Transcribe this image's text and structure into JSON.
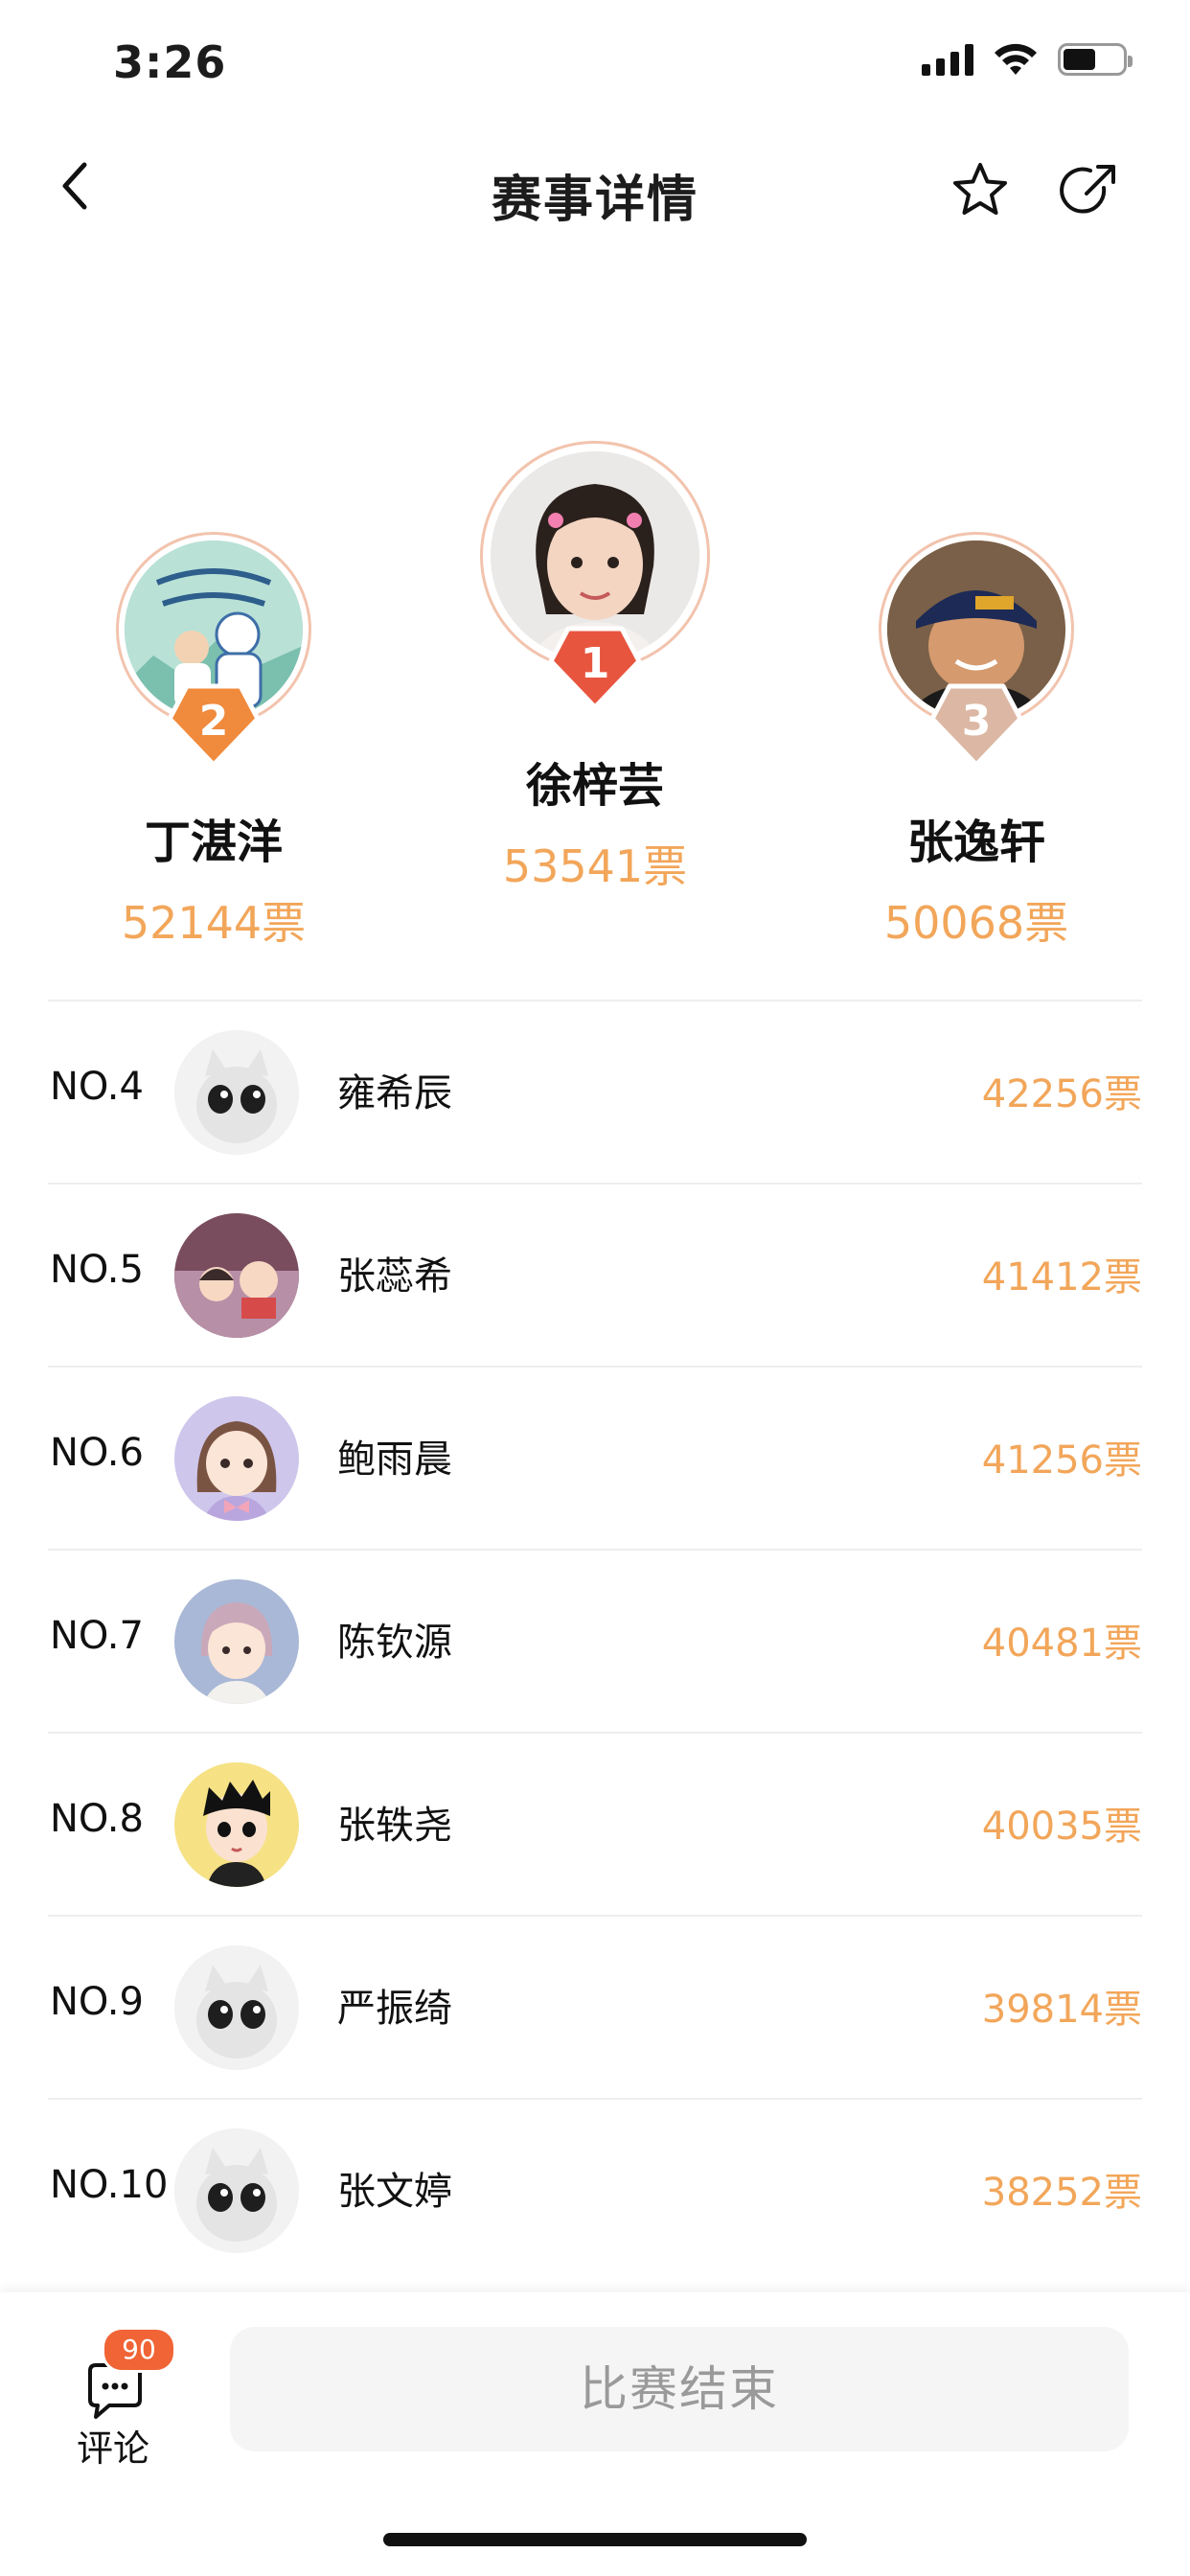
{
  "status": {
    "time": "3:26"
  },
  "nav": {
    "title": "赛事详情"
  },
  "podium": [
    {
      "rank": "2",
      "name": "丁湛洋",
      "votes": "52144票"
    },
    {
      "rank": "1",
      "name": "徐梓芸",
      "votes": "53541票"
    },
    {
      "rank": "3",
      "name": "张逸轩",
      "votes": "50068票"
    }
  ],
  "list": [
    {
      "rank": "NO.4",
      "name": "雍希辰",
      "votes": "42256票"
    },
    {
      "rank": "NO.5",
      "name": "张蕊希",
      "votes": "41412票"
    },
    {
      "rank": "NO.6",
      "name": "鲍雨晨",
      "votes": "41256票"
    },
    {
      "rank": "NO.7",
      "name": "陈钦源",
      "votes": "40481票"
    },
    {
      "rank": "NO.8",
      "name": "张轶尧",
      "votes": "40035票"
    },
    {
      "rank": "NO.9",
      "name": "严振绮",
      "votes": "39814票"
    },
    {
      "rank": "NO.10",
      "name": "张文婷",
      "votes": "38252票"
    }
  ],
  "bottom": {
    "comment_label": "评论",
    "comment_count": "90",
    "end_label": "比赛结束"
  },
  "colors": {
    "accent": "#f2a65a",
    "badge": "#f06436",
    "rank1": "#e8553f",
    "rank2": "#f08a3c",
    "rank3": "#dcb8a4"
  }
}
